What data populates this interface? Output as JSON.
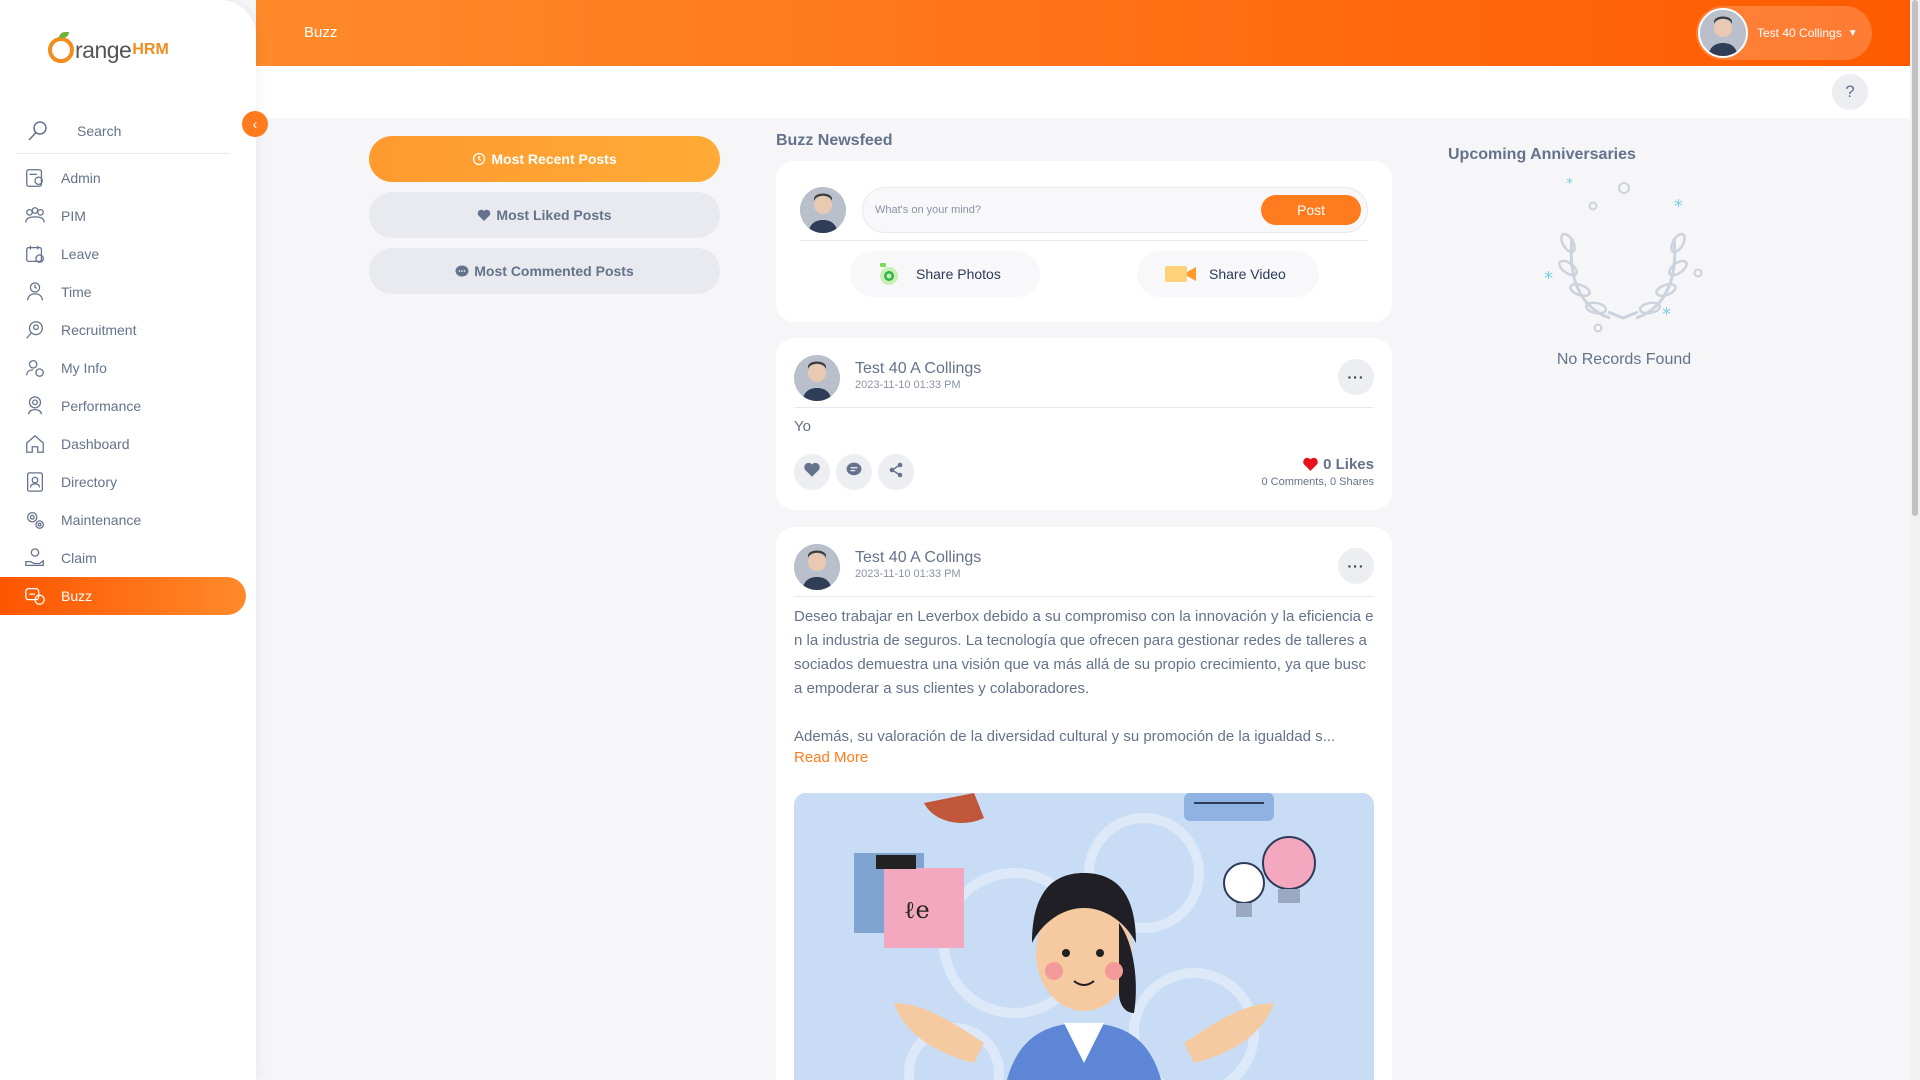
{
  "app": {
    "brand_prefix": "range",
    "brand_suffix": "HRM"
  },
  "topbar": {
    "title": "Buzz",
    "user_name": "Test 40 Collings"
  },
  "sidebar": {
    "search_label": "Search",
    "items": [
      {
        "label": "Admin",
        "icon": "admin-icon"
      },
      {
        "label": "PIM",
        "icon": "pim-icon"
      },
      {
        "label": "Leave",
        "icon": "leave-icon"
      },
      {
        "label": "Time",
        "icon": "time-icon"
      },
      {
        "label": "Recruitment",
        "icon": "recruitment-icon"
      },
      {
        "label": "My Info",
        "icon": "my-info-icon"
      },
      {
        "label": "Performance",
        "icon": "performance-icon"
      },
      {
        "label": "Dashboard",
        "icon": "dashboard-icon"
      },
      {
        "label": "Directory",
        "icon": "directory-icon"
      },
      {
        "label": "Maintenance",
        "icon": "maintenance-icon"
      },
      {
        "label": "Claim",
        "icon": "claim-icon"
      },
      {
        "label": "Buzz",
        "icon": "buzz-icon",
        "active": true
      }
    ]
  },
  "filters": {
    "most_recent": "Most Recent Posts",
    "most_liked": "Most Liked Posts",
    "most_commented": "Most Commented Posts"
  },
  "feed": {
    "title": "Buzz Newsfeed",
    "composer": {
      "placeholder": "What's on your mind?",
      "post_label": "Post",
      "share_photos": "Share Photos",
      "share_video": "Share Video"
    },
    "posts": [
      {
        "author": "Test 40 A Collings",
        "date": "2023-11-10 01:33 PM",
        "text": "Yo",
        "likes": "0 Likes",
        "comments": "0 Comments",
        "shares": "0 Shares"
      },
      {
        "author": "Test 40 A Collings",
        "date": "2023-11-10 01:33 PM",
        "para1": "Deseo trabajar en Leverbox debido a su compromiso con la innovación y la eficiencia en la industria de seguros. La tecnología que ofrecen para gestionar redes de talleres asociados demuestra una visión que va más allá de su propio crecimiento, ya que busca empoderar a sus clientes y colaboradores.",
        "para2": "Además, su valoración de la diversidad cultural y su promoción de la igualdad s...",
        "read_more": "Read More"
      }
    ]
  },
  "anniversaries": {
    "title": "Upcoming Anniversaries",
    "empty": "No Records Found"
  },
  "colors": {
    "accent": "#ff7b1d",
    "gradient_start": "#ff8a2a",
    "gradient_end": "#ff5a00",
    "text": "#64728c"
  }
}
